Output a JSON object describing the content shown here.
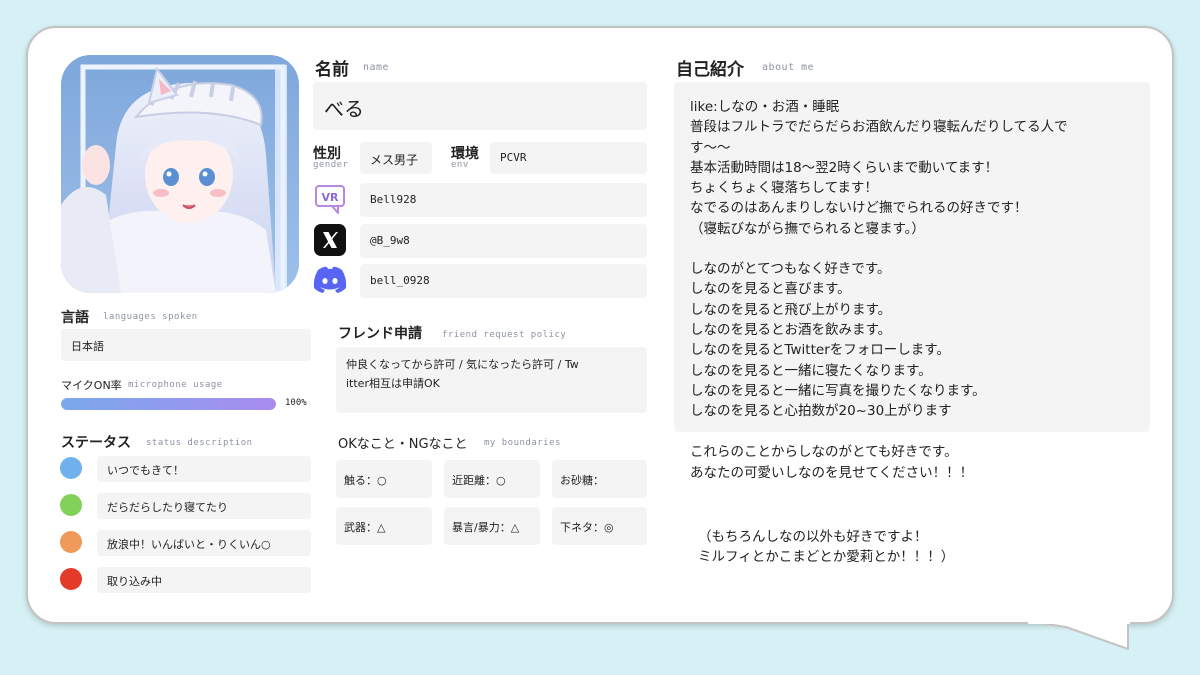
{
  "profile": {
    "name_jp": "名前",
    "name_en": "name",
    "name_value": "べる",
    "gender_jp": "性別",
    "gender_en": "gender",
    "gender_value": "メス男子",
    "env_jp": "環境",
    "env_en": "env",
    "env_value": "PCVR",
    "vrchat_id": "Bell928",
    "x_handle": "@B_9w8",
    "discord_id": "bell_0928"
  },
  "languages": {
    "title_jp": "言語",
    "title_en": "languages spoken",
    "value": "日本語"
  },
  "microphone": {
    "title": "マイクON率",
    "title_en": "microphone usage",
    "percent_label": "100%",
    "fraction": 1.0
  },
  "status": {
    "title_jp": "ステータス",
    "title_en": "status description",
    "items": [
      {
        "color": "#6fb0ee",
        "label": "いつでもきて！"
      },
      {
        "color": "#82d25a",
        "label": "だらだらしたり寝てたり"
      },
      {
        "color": "#ef9a5a",
        "label": "放浪中！いんばいと・りくいん○"
      },
      {
        "color": "#e33a2a",
        "label": "取り込み中"
      }
    ]
  },
  "friend_policy": {
    "title_jp": "フレンド申請",
    "title_en": "friend request policy",
    "line1": "仲良くなってから許可 / 気になったら許可 / Tw",
    "line2": "itter相互は申請OK"
  },
  "boundaries": {
    "title_jp": "OKなこと・NGなこと",
    "title_en": "my boundaries",
    "items": [
      {
        "label": "触る：○"
      },
      {
        "label": "近距離：○"
      },
      {
        "label": "お砂糖："
      },
      {
        "label": "武器：△"
      },
      {
        "label": "暴言/暴力：△"
      },
      {
        "label": "下ネタ：◎"
      }
    ]
  },
  "about": {
    "title_jp": "自己紹介",
    "title_en": "about me",
    "p1": [
      "like:しなの・お酒・睡眠",
      "普段はフルトラでだらだらお酒飲んだり寝転んだりしてる人で",
      "す～～",
      "基本活動時間は18～翌2時くらいまで動いてます！",
      "ちょくちょく寝落ちしてます！",
      "なでるのはあんまりしないけど撫でられるの好きです！",
      "（寝転びながら撫でられると寝ます。）"
    ],
    "p2": [
      "しなのがとてつもなく好きです。",
      "しなのを見ると喜びます。",
      "しなのを見ると飛び上がります。",
      "しなのを見るとお酒を飲みます。",
      "しなのを見るとTwitterをフォローします。",
      "しなのを見ると一緒に寝たくなります。",
      "しなのを見ると一緒に写真を撮りたくなります。",
      "しなのを見ると心拍数が20~30上がります"
    ],
    "p3": [
      "これらのことからしなのがとても好きです。",
      "あなたの可愛いしなのを見せてください！！！"
    ],
    "p4": [
      "（もちろんしなの以外も好きですよ！",
      "ミルフィとかこまどとか愛莉とか！！！）"
    ]
  }
}
